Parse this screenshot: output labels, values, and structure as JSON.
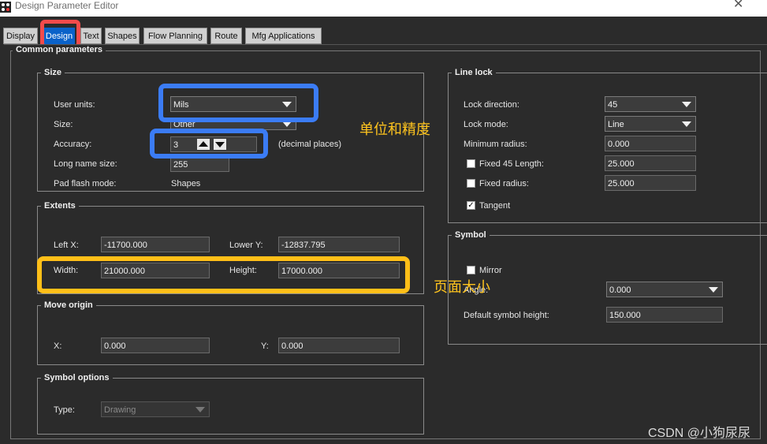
{
  "window": {
    "title": "Design Parameter Editor",
    "close_glyph": "✕"
  },
  "tabs": [
    "Display",
    "Design",
    "Text",
    "Shapes",
    "Flow Planning",
    "Route",
    "Mfg Applications"
  ],
  "active_tab": "Design",
  "panel": {
    "title": "Common parameters"
  },
  "size": {
    "title": "Size",
    "user_units_label": "User units:",
    "user_units_value": "Mils",
    "size_label": "Size:",
    "size_value": "Other",
    "accuracy_label": "Accuracy:",
    "accuracy_value": "3",
    "accuracy_suffix": "(decimal places)",
    "long_name_label": "Long name size:",
    "long_name_value": "255",
    "pad_flash_label": "Pad flash mode:",
    "pad_flash_value": "Shapes"
  },
  "extents": {
    "title": "Extents",
    "left_x_label": "Left X:",
    "left_x_value": "-11700.000",
    "lower_y_label": "Lower Y:",
    "lower_y_value": "-12837.795",
    "width_label": "Width:",
    "width_value": "21000.000",
    "height_label": "Height:",
    "height_value": "17000.000"
  },
  "move_origin": {
    "title": "Move origin",
    "x_label": "X:",
    "x_value": "0.000",
    "y_label": "Y:",
    "y_value": "0.000"
  },
  "symbol_options": {
    "title": "Symbol options",
    "type_label": "Type:",
    "type_value": "Drawing"
  },
  "line_lock": {
    "title": "Line lock",
    "direction_label": "Lock direction:",
    "direction_value": "45",
    "mode_label": "Lock mode:",
    "mode_value": "Line",
    "min_radius_label": "Minimum radius:",
    "min_radius_value": "0.000",
    "fixed45_label": "Fixed 45 Length:",
    "fixed45_value": "25.000",
    "fixed45_checked": false,
    "fixed_radius_label": "Fixed radius:",
    "fixed_radius_value": "25.000",
    "fixed_radius_checked": false,
    "tangent_label": "Tangent",
    "tangent_checked": true,
    "check_glyph": "✓"
  },
  "symbol": {
    "title": "Symbol",
    "mirror_label": "Mirror",
    "mirror_checked": false,
    "angle_label": "Angle:",
    "angle_value": "0.000",
    "default_height_label": "Default symbol height:",
    "default_height_value": "150.000"
  },
  "annotations": {
    "units_precision": "单位和精度",
    "page_size": "页面大小"
  },
  "watermark": "CSDN @小狗尿尿",
  "colors": {
    "highlight_blue": "#3b7cf5",
    "highlight_gold": "#ffbf18",
    "highlight_red": "#f24b4b",
    "active_tab": "#0a62c9"
  }
}
